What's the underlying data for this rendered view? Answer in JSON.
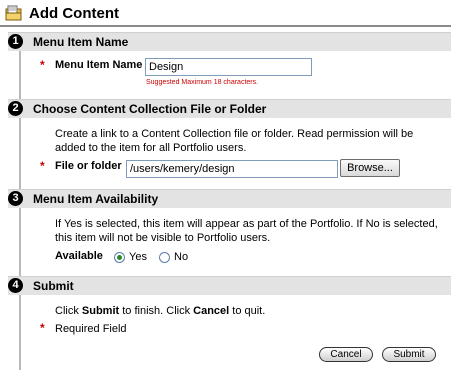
{
  "header": {
    "title": "Add Content",
    "icon": "folder-page-icon"
  },
  "steps": [
    {
      "number": "1",
      "title": "Menu Item Name",
      "field_label": "Menu Item Name",
      "field_value": "Design",
      "hint": "Suggested Maximum 18 characters."
    },
    {
      "number": "2",
      "title": "Choose Content Collection File or Folder",
      "description": "Create a link to a Content Collection file or folder. Read permission will be added to the item for all Portfolio users.",
      "field_label": "File or folder",
      "field_value": "/users/kemery/design",
      "browse_label": "Browse..."
    },
    {
      "number": "3",
      "title": "Menu Item Availability",
      "description": "If Yes is selected, this item will appear as part of the Portfolio. If No is selected, this item will not be visible to Portfolio users.",
      "field_label": "Available",
      "options": [
        {
          "label": "Yes",
          "selected": true
        },
        {
          "label": "No",
          "selected": false
        }
      ]
    },
    {
      "number": "4",
      "title": "Submit",
      "instruction_pre": "Click ",
      "instruction_submit": "Submit",
      "instruction_mid": " to finish. Click ",
      "instruction_cancel": "Cancel",
      "instruction_post": " to quit.",
      "required_note": "Required Field",
      "cancel_label": "Cancel",
      "submit_label": "Submit"
    }
  ],
  "required_marker": "*",
  "colors": {
    "required": "#cc0000",
    "step_bar": "#e3e3e3",
    "radio_selected": "#2a8a2a"
  }
}
